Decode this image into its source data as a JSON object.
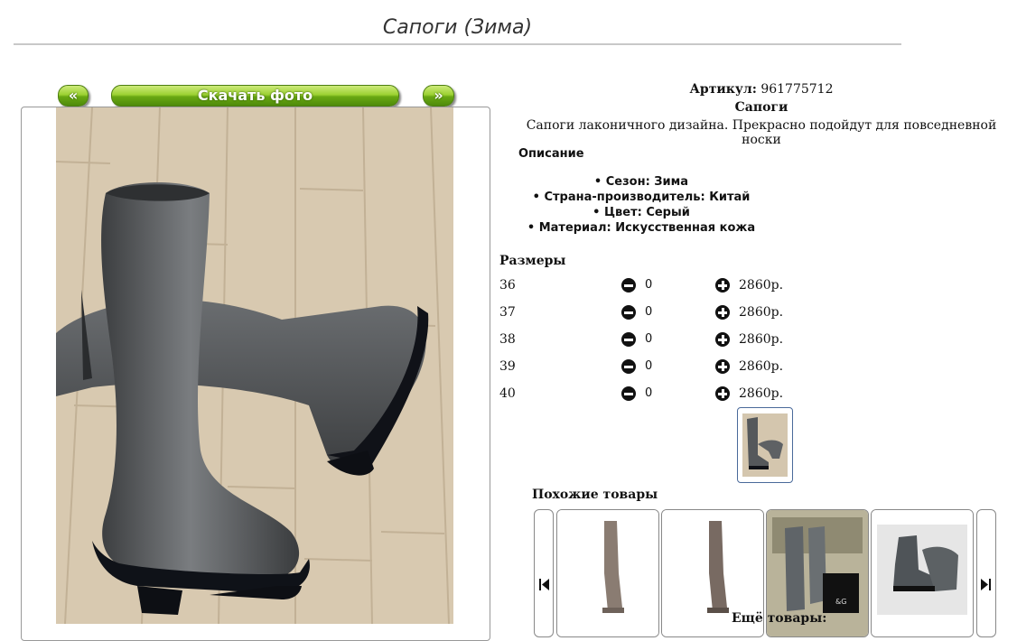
{
  "page": {
    "title": "Сапоги (Зима)"
  },
  "photo_nav": {
    "prev": "«",
    "download": "Скачать фото",
    "next": "»"
  },
  "product": {
    "article_label": "Артикул:",
    "article_value": "961775712",
    "name": "Сапоги",
    "tagline": "Сапоги лаконичного дизайна. Прекрасно подойдут для повседневной носки",
    "description_heading": "Описание",
    "features": [
      "• Сезон: Зима",
      "• Страна-производитель: Китай",
      "• Цвет: Серый",
      "• Материал: Искусственная кожа"
    ]
  },
  "sizes": {
    "heading": "Размеры",
    "rows": [
      {
        "size": "36",
        "qty": "0",
        "price": "2860р."
      },
      {
        "size": "37",
        "qty": "0",
        "price": "2860р."
      },
      {
        "size": "38",
        "qty": "0",
        "price": "2860р."
      },
      {
        "size": "39",
        "qty": "0",
        "price": "2860р."
      },
      {
        "size": "40",
        "qty": "0",
        "price": "2860р."
      }
    ]
  },
  "similar": {
    "heading": "Похожие товары",
    "more": "Ещё товары:"
  },
  "colors": {
    "button_green": "#6aab14",
    "boot": "#55585b",
    "floor": "#d9cbb4"
  }
}
